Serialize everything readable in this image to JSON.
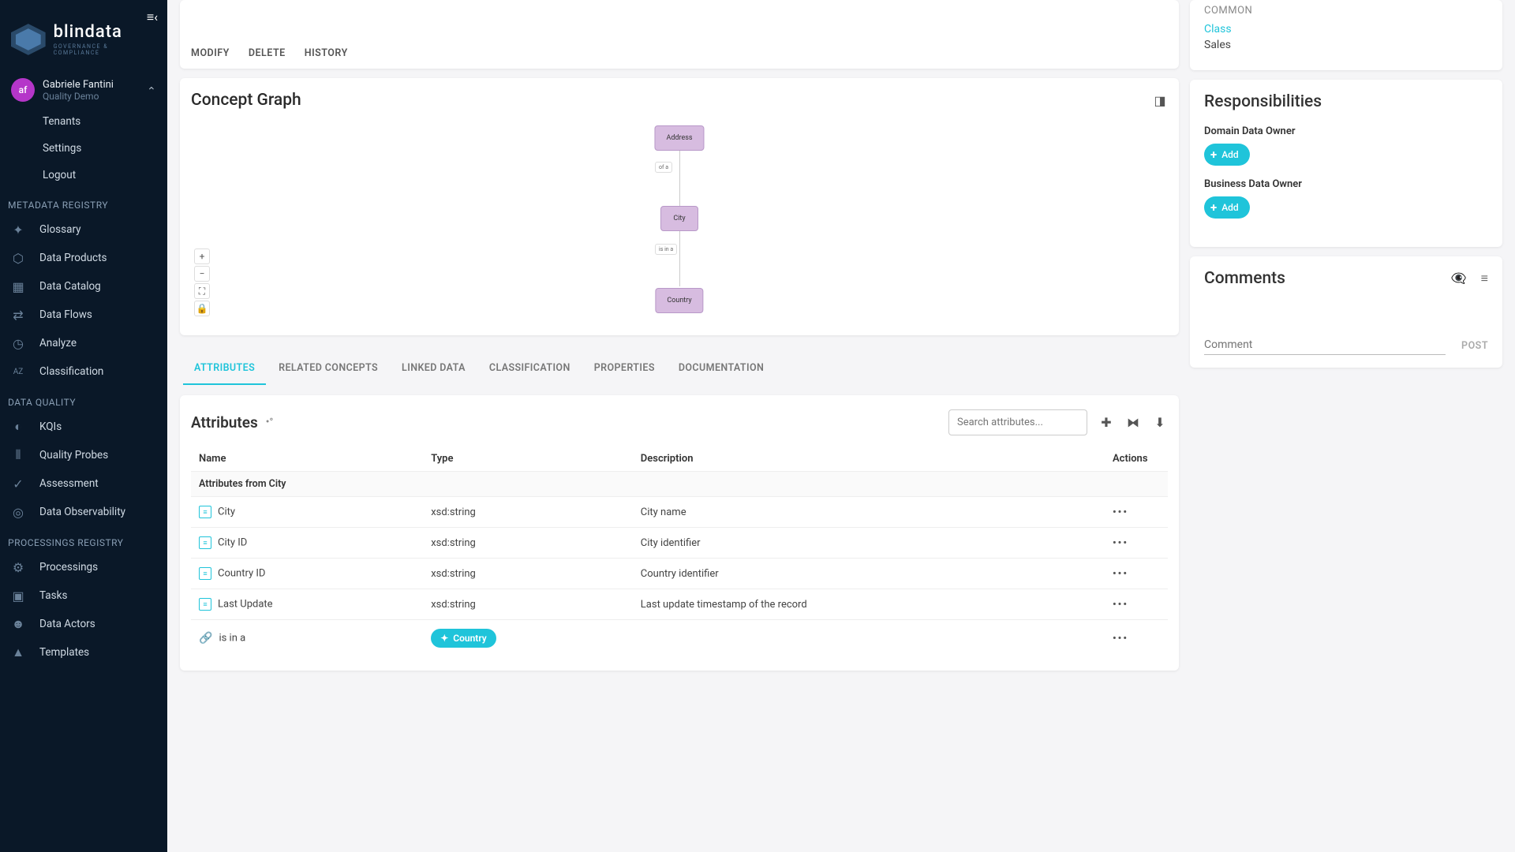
{
  "logo": {
    "name": "blindata",
    "tagline": "GOVERNANCE & COMPLIANCE"
  },
  "user": {
    "initials": "af",
    "name": "Gabriele Fantini",
    "tenant": "Quality Demo"
  },
  "userMenu": [
    "Tenants",
    "Settings",
    "Logout"
  ],
  "sections": [
    {
      "label": "METADATA REGISTRY",
      "items": [
        "Glossary",
        "Data Products",
        "Data Catalog",
        "Data Flows",
        "Analyze",
        "Classification"
      ]
    },
    {
      "label": "DATA QUALITY",
      "items": [
        "KQIs",
        "Quality Probes",
        "Assessment",
        "Data Observability"
      ]
    },
    {
      "label": "PROCESSINGS REGISTRY",
      "items": [
        "Processings",
        "Tasks",
        "Data Actors",
        "Templates"
      ]
    }
  ],
  "actions": [
    "MODIFY",
    "DELETE",
    "HISTORY"
  ],
  "graph": {
    "title": "Concept Graph",
    "nodes": [
      "Address",
      "City",
      "Country"
    ],
    "relations": [
      "of a",
      "is in a"
    ]
  },
  "tabs": [
    "ATTRIBUTES",
    "RELATED CONCEPTS",
    "LINKED DATA",
    "CLASSIFICATION",
    "PROPERTIES",
    "DOCUMENTATION"
  ],
  "attrPanel": {
    "title": "Attributes",
    "searchPlaceholder": "Search attributes...",
    "columns": [
      "Name",
      "Type",
      "Description",
      "Actions"
    ],
    "groupLabel": "Attributes from City",
    "rows": [
      {
        "name": "City",
        "type": "xsd:string",
        "desc": "City name"
      },
      {
        "name": "City ID",
        "type": "xsd:string",
        "desc": "City identifier"
      },
      {
        "name": "Country ID",
        "type": "xsd:string",
        "desc": "Country identifier"
      },
      {
        "name": "Last Update",
        "type": "xsd:string",
        "desc": "Last update timestamp of the record"
      }
    ],
    "linkRow": {
      "label": "is in a",
      "chip": "Country"
    }
  },
  "common": {
    "label": "COMMON",
    "class": "Class",
    "value": "Sales"
  },
  "resp": {
    "title": "Responsibilities",
    "roles": [
      "Domain Data Owner",
      "Business Data Owner"
    ],
    "add": "Add"
  },
  "comments": {
    "title": "Comments",
    "placeholder": "Comment",
    "post": "POST"
  }
}
